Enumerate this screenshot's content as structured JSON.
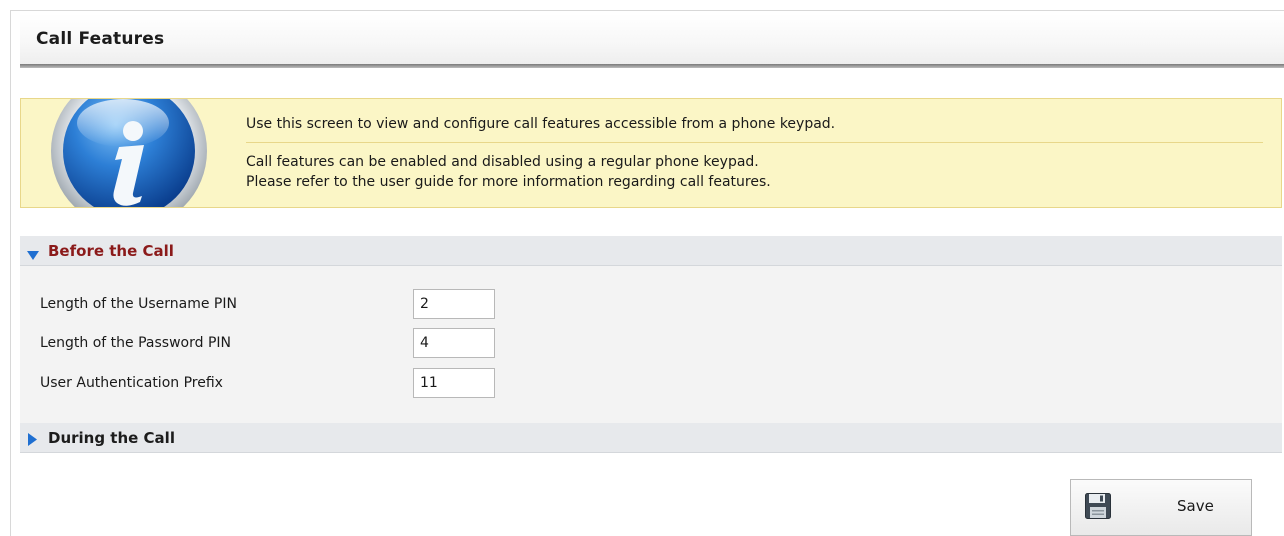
{
  "page": {
    "title": "Call Features"
  },
  "info": {
    "icon": "info-icon",
    "line1": "Use this screen to view and configure call features accessible from a phone keypad.",
    "line2": "Call features can be enabled and disabled using a regular phone keypad.",
    "line3": "Please refer to the user guide for more information regarding call features."
  },
  "sections": {
    "before": {
      "label": "Before the Call",
      "state": "expanded",
      "fields": [
        {
          "label": "Length of the Username PIN",
          "value": "2"
        },
        {
          "label": "Length of the Password PIN",
          "value": "4"
        },
        {
          "label": "User Authentication Prefix",
          "value": "11"
        }
      ]
    },
    "during": {
      "label": "During the Call",
      "state": "collapsed"
    }
  },
  "actions": {
    "save_label": "Save",
    "save_icon": "floppy-disk-icon"
  },
  "colors": {
    "info_background": "#fbf6c6",
    "section_header": "#e7e9ec",
    "expanded_section_text": "#8b1a1a",
    "arrow_blue": "#1f6fd1"
  }
}
